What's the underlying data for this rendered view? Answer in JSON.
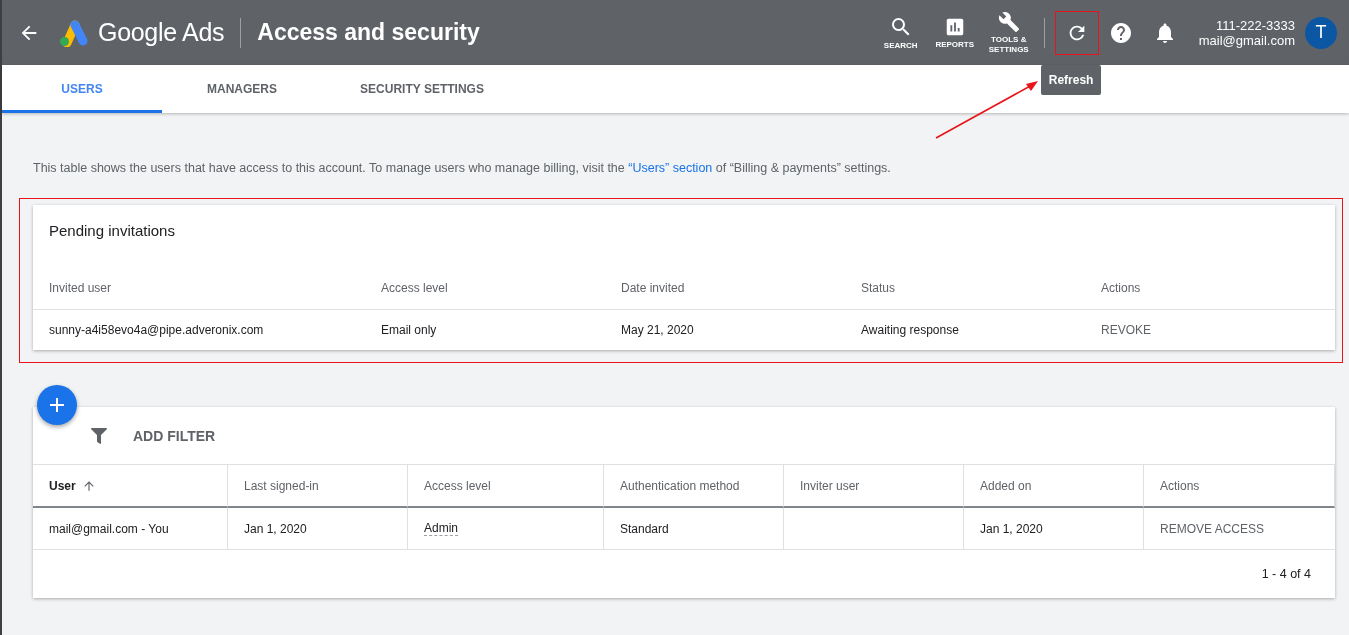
{
  "header": {
    "product": "Google Ads",
    "title": "Access and security",
    "nav": [
      {
        "kind": "search",
        "label": "SEARCH"
      },
      {
        "kind": "reports",
        "label": "REPORTS"
      },
      {
        "kind": "tools",
        "label": "TOOLS & SETTINGS"
      }
    ],
    "refresh_tooltip": "Refresh",
    "phone": "111-222-3333",
    "email": "mail@gmail.com",
    "avatar": "T"
  },
  "tabs": [
    {
      "label": "USERS",
      "selected": true
    },
    {
      "label": "MANAGERS",
      "selected": false
    },
    {
      "label": "SECURITY SETTINGS",
      "selected": false
    }
  ],
  "intro": {
    "before": "This table shows the users that have access to this account. To manage users who manage billing, visit the ",
    "link": "“Users” section",
    "after": " of “Billing & payments” settings."
  },
  "pending": {
    "title": "Pending invitations",
    "columns": [
      "Invited user",
      "Access level",
      "Date invited",
      "Status",
      "Actions"
    ],
    "rows": [
      [
        "sunny-a4i58evo4a@pipe.adveronix.com",
        "Email only",
        "May 21, 2020",
        "Awaiting response",
        "REVOKE"
      ]
    ]
  },
  "users": {
    "filter": "ADD FILTER",
    "columns": [
      {
        "label": "User",
        "sorted": true
      },
      {
        "label": "Last signed-in",
        "sorted": false
      },
      {
        "label": "Access level",
        "sorted": false
      },
      {
        "label": "Authentication method",
        "sorted": false
      },
      {
        "label": "Inviter user",
        "sorted": false
      },
      {
        "label": "Added on",
        "sorted": false
      },
      {
        "label": "Actions",
        "sorted": false
      }
    ],
    "rows": [
      [
        "mail@gmail.com - You",
        "Jan 1, 2020",
        "Admin",
        "Standard",
        null,
        "Jan 1, 2020",
        "REMOVE ACCESS"
      ]
    ],
    "pagination": "1 - 4 of 4"
  }
}
